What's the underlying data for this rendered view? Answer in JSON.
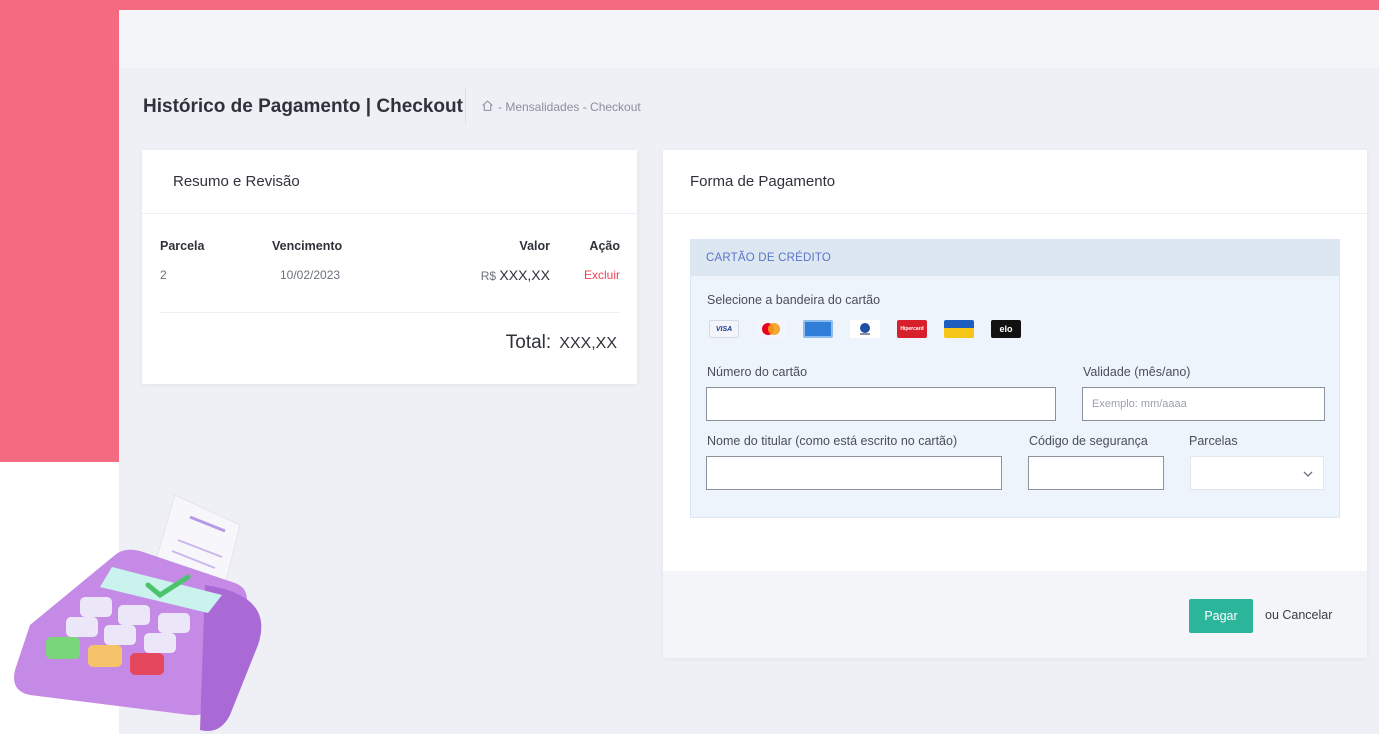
{
  "page": {
    "title": "Histórico de Pagamento | Checkout",
    "breadcrumb": "- Mensalidades - Checkout"
  },
  "summary": {
    "header": "Resumo e Revisão",
    "columns": [
      "Parcela",
      "Vencimento",
      "Valor",
      "Ação"
    ],
    "rows": [
      {
        "parcela": "2",
        "vencimento": "10/02/2023",
        "currency": "R$",
        "valor": "XXX,XX",
        "acao": "Excluir"
      }
    ],
    "total_label": "Total:",
    "total_value": "XXX,XX"
  },
  "payment": {
    "header": "Forma de Pagamento",
    "credit_card_tab": "CARTÃO DE CRÉDITO",
    "brand_label": "Selecione a bandeira do cartão",
    "brands": [
      "visa",
      "mastercard",
      "amex",
      "diners",
      "hipercard",
      "hiper",
      "elo"
    ],
    "brand_texts": {
      "visa": "VISA",
      "hipercard": "Hipercard",
      "elo": "elo"
    },
    "card_number_label": "Número do cartão",
    "card_number_value": "",
    "expiry_label": "Validade (mês/ano)",
    "expiry_placeholder": "Exemplo: mm/aaaa",
    "holder_label": "Nome do titular (como está escrito no cartão)",
    "holder_value": "",
    "cvv_label": "Código de segurança",
    "cvv_value": "",
    "installments_label": "Parcelas",
    "installments_value": "",
    "pay_button": "Pagar",
    "cancel_text": "ou Cancelar"
  },
  "colors": {
    "background_pink": "#f46a80",
    "app_background": "#eef0f6",
    "accent_green": "#2bb59a",
    "danger_red": "#f04452",
    "tab_blue": "#5a74c9"
  }
}
